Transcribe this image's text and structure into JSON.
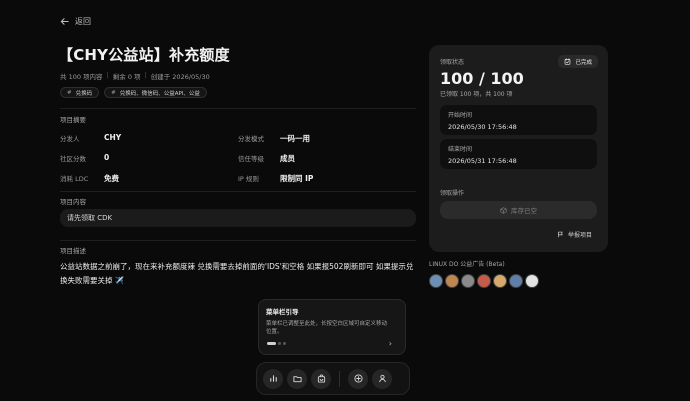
{
  "nav": {
    "back_label": "返回"
  },
  "project": {
    "title": "【CHY公益站】补充额度",
    "meta": [
      "共 100 项内容",
      "剩余 0 项",
      "创建于 2026/05/30"
    ],
    "tags": [
      "兑换码",
      "兑换码、微信码、公益API、公益"
    ]
  },
  "summary": {
    "label": "项目摘要",
    "rows": [
      [
        {
          "k": "分发人",
          "v": "CHY"
        },
        {
          "k": "分发模式",
          "v": "一码一用"
        }
      ],
      [
        {
          "k": "社区分数",
          "v": "0"
        },
        {
          "k": "信任等级",
          "v": "成员"
        }
      ],
      [
        {
          "k": "消耗 LDC",
          "v": "免费"
        },
        {
          "k": "IP 规则",
          "v": "限制同 IP"
        }
      ]
    ]
  },
  "content": {
    "label": "项目内容",
    "placeholder": "请先领取 CDK"
  },
  "description": {
    "label": "项目描述",
    "text": "公益站数据之前崩了，现在来补充额度辣 兑换需要去掉前面的'IDS'和空格 如果报502刷新即可 如果提示兑换失败需要关掉 ✈️"
  },
  "guide": {
    "title": "菜单栏引导",
    "text": "菜单栏已调整至此处，长按空白区域可自定义移动位置。",
    "next": "›"
  },
  "dock": {
    "icons": [
      "chart-icon",
      "folder-icon",
      "bag-icon",
      "plus-icon",
      "user-icon"
    ]
  },
  "side": {
    "label": "领取状态",
    "status": "已完成",
    "count": "100 / 100",
    "sub": "已领取 100 项，共 100 项",
    "start_label": "开始时间",
    "start_value": "2026/05/30 17:56:48",
    "end_label": "结束时间",
    "end_value": "2026/05/31 17:56:48",
    "action_label": "领取操作",
    "action_button": "库存已空",
    "report": "举报项目"
  },
  "ad": {
    "label": "LINUX DO 公益广告 (Beta)",
    "avatar_colors": [
      "#6b8fb5",
      "#c0864f",
      "#8a8a8a",
      "#c75b4a",
      "#d6a86b",
      "#5f7fa8",
      "#e3e3e3"
    ]
  }
}
